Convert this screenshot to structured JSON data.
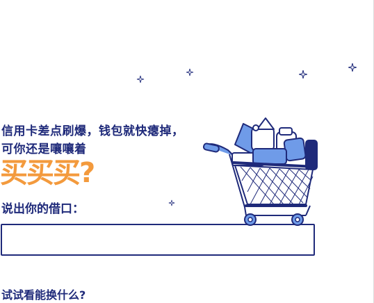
{
  "headline": {
    "line1": "信用卡差点刷爆，钱包就快瘪掉，",
    "line2": "可你还是嚷嚷着"
  },
  "big_word": "买买买?",
  "prompt_label": "说出你的借口：",
  "excuse_input": {
    "value": "",
    "placeholder": ""
  },
  "try_link": "试试看能换什么?",
  "colors": {
    "navy": "#1f2a7a",
    "orange": "#f39a3d",
    "cart_blue": "#6f9be8"
  },
  "icons": [
    "sparkle-icon",
    "shopping-cart-icon"
  ]
}
